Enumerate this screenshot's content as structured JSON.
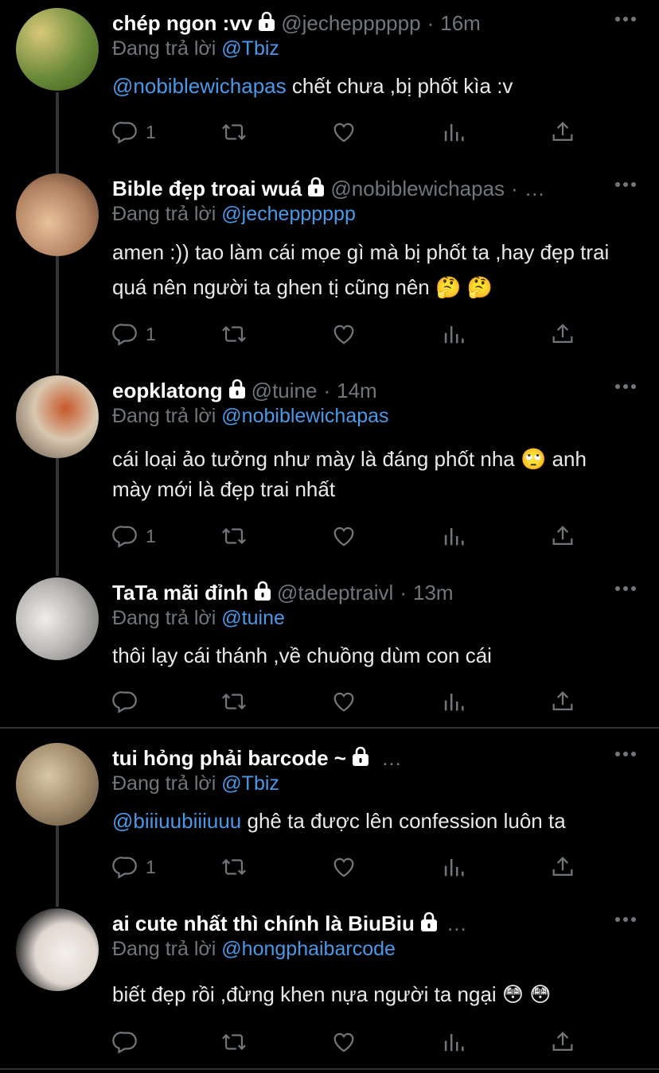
{
  "labels": {
    "replying_prefix": "Đang trả lời"
  },
  "tweets": [
    {
      "name": "chép ngon :vv",
      "handle": "@jechepppppp",
      "time": "16m",
      "reply_to": "@Tbiz",
      "mention": "@nobiblewichapas",
      "text": " chết chưa ,bị phốt kìa :v",
      "reply_count": "1",
      "avatar_colors": [
        "#c8b86a",
        "#5a7a2e"
      ]
    },
    {
      "name": "Bible đẹp troai wuá",
      "handle": "@nobiblewichapas",
      "time": "",
      "truncated": "…",
      "reply_to": "@jechepppppp",
      "mention": "",
      "text": "amen :)) tao làm cái mọe gì mà bị phốt ta ,hay đẹp trai quá nên người ta ghen tị cũng nên 🤔 🤔",
      "reply_count": "1",
      "avatar_colors": [
        "#d9b08c",
        "#8a6a50"
      ]
    },
    {
      "name": "eopklatong",
      "handle": "@tuine",
      "time": "14m",
      "reply_to": "@nobiblewichapas",
      "mention": "",
      "text": "cái loại ảo tưởng như mày là đáng phốt nha 🙄 anh mày mới là đẹp trai nhất",
      "reply_count": "1",
      "avatar_colors": [
        "#d9c9b8",
        "#b46a3a"
      ]
    },
    {
      "name": "TaTa mãi đỉnh",
      "handle": "@tadeptraivl",
      "time": "13m",
      "reply_to": "@tuine",
      "mention": "",
      "text": "thôi lạy cái thánh ,về chuồng dùm con cái",
      "reply_count": "",
      "avatar_colors": [
        "#d8d6d2",
        "#8a8a88"
      ]
    },
    {
      "name": "tui hỏng phải barcode ~",
      "handle": "",
      "time": "",
      "truncated": "…",
      "reply_to": "@Tbiz",
      "mention": "@biiiuubiiiuuu",
      "text": " ghê ta được lên confession luôn ta",
      "reply_count": "1",
      "avatar_colors": [
        "#c7b89c",
        "#7a6a52"
      ]
    },
    {
      "name": "ai cute nhất thì chính là BiuBiu",
      "handle": "",
      "time": "",
      "truncated": "…",
      "reply_to": "@hongphaibarcode",
      "mention": "",
      "text": "biết đẹp rồi ,đừng khen nựa người ta ngại 😳 😳",
      "reply_count": "",
      "avatar_colors": [
        "#f0ece8",
        "#2a2a2a"
      ]
    }
  ],
  "icons": [
    "reply-icon",
    "retweet-icon",
    "like-icon",
    "analytics-icon",
    "share-icon",
    "lock-icon",
    "more-icon"
  ],
  "colors": {
    "background": "#000000",
    "mention": "#4a99e9",
    "muted": "#71767b",
    "thread_line": "#333639"
  }
}
